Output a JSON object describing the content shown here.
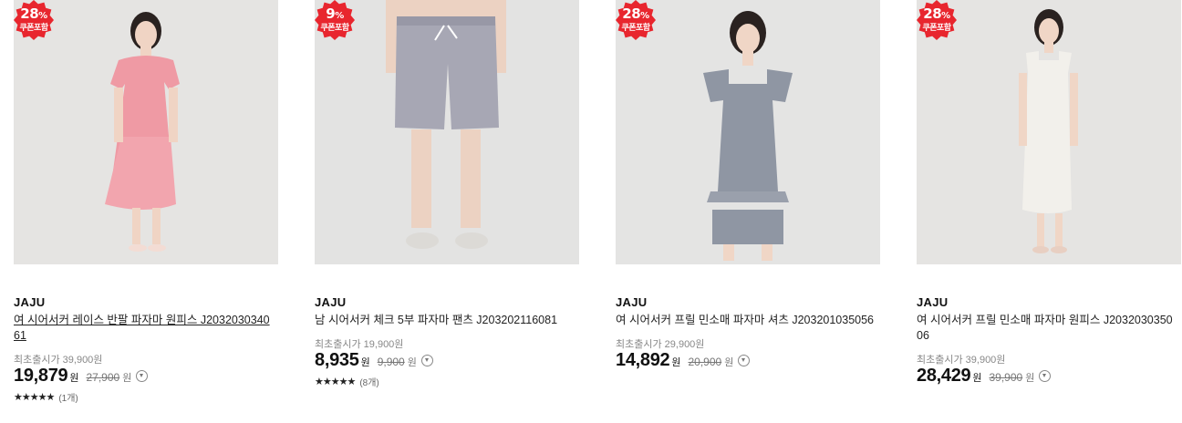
{
  "products": [
    {
      "discount": "28",
      "discount_unit": "%",
      "coupon": "쿠폰포함",
      "brand": "JAJU",
      "name": "여 시어서커 레이스 반팔 파자마 원피스 J2032030340 61",
      "orig_label": "최초출시가 39,900원",
      "price": "19,879",
      "won": "원",
      "list_price": "27,900",
      "list_won": "원",
      "stars": "★★★★★",
      "review_count": "(1개)",
      "illustration": "pink-gingham-dress"
    },
    {
      "discount": "9",
      "discount_unit": "%",
      "coupon": "쿠폰포함",
      "brand": "JAJU",
      "name": "남 시어서커 체크 5부 파자마 팬츠 J203202116081",
      "orig_label": "최초출시가 19,900원",
      "price": "8,935",
      "won": "원",
      "list_price": "9,900",
      "list_won": "원",
      "stars": "★★★★★",
      "review_count": "(8개)",
      "illustration": "plaid-shorts"
    },
    {
      "discount": "28",
      "discount_unit": "%",
      "coupon": "쿠폰포함",
      "brand": "JAJU",
      "name": "여 시어서커 프릴 민소매 파자마 셔츠 J203201035056",
      "orig_label": "최초출시가 29,900원",
      "price": "14,892",
      "won": "원",
      "list_price": "20,900",
      "list_won": "원",
      "illustration": "gray-frill-set"
    },
    {
      "discount": "28",
      "discount_unit": "%",
      "coupon": "쿠폰포함",
      "brand": "JAJU",
      "name": "여 시어서커 프릴 민소매 파자마 원피스 J2032030350 06",
      "orig_label": "최초출시가 39,900원",
      "price": "28,429",
      "won": "원",
      "list_price": "39,900",
      "list_won": "원",
      "illustration": "white-frill-dress"
    }
  ],
  "colors": {
    "badge": "#e8262e",
    "image_bg": "#e3e3e3"
  }
}
